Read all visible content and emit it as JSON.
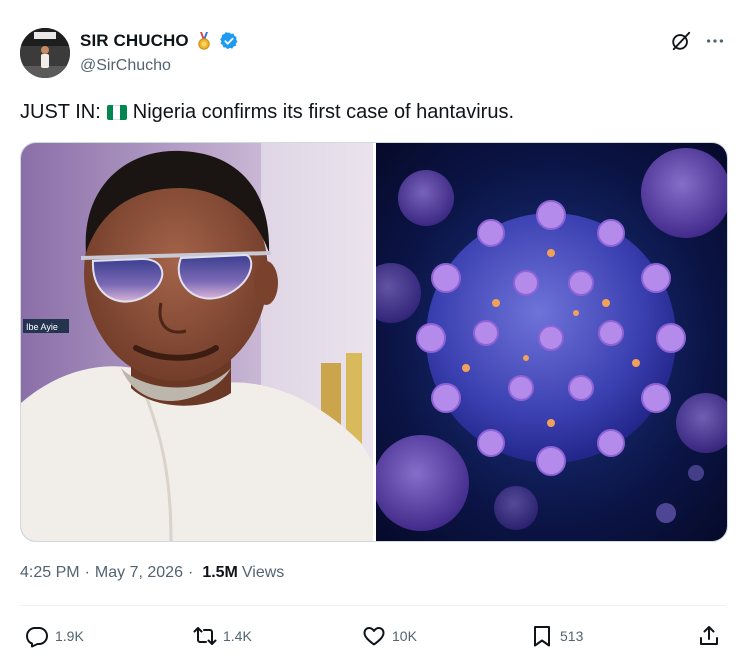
{
  "author": {
    "display_name": "SIR CHUCHO",
    "handle": "@SirChucho",
    "badges": [
      "medal-icon",
      "verified-icon"
    ]
  },
  "tweet": {
    "text_before_flag": "JUST IN:",
    "flag": "nigeria-flag",
    "text_after_flag": "Nigeria confirms its first case of hantavirus.",
    "media_watermark": "Ibe Ayie"
  },
  "meta": {
    "time": "4:25 PM",
    "separator": "·",
    "date": "May 7, 2026",
    "views_count": "1.5M",
    "views_label": "Views"
  },
  "actions": {
    "reply_count": "1.9K",
    "repost_count": "1.4K",
    "like_count": "10K",
    "bookmark_count": "513"
  },
  "colors": {
    "text_primary": "#0f1419",
    "text_secondary": "#536471",
    "verified_blue": "#1d9bf0",
    "nigeria_green": "#008751",
    "border": "#cfd9de"
  },
  "icons": [
    "grok-icon",
    "more-icon",
    "reply-icon",
    "repost-icon",
    "like-icon",
    "bookmark-icon",
    "share-icon"
  ]
}
